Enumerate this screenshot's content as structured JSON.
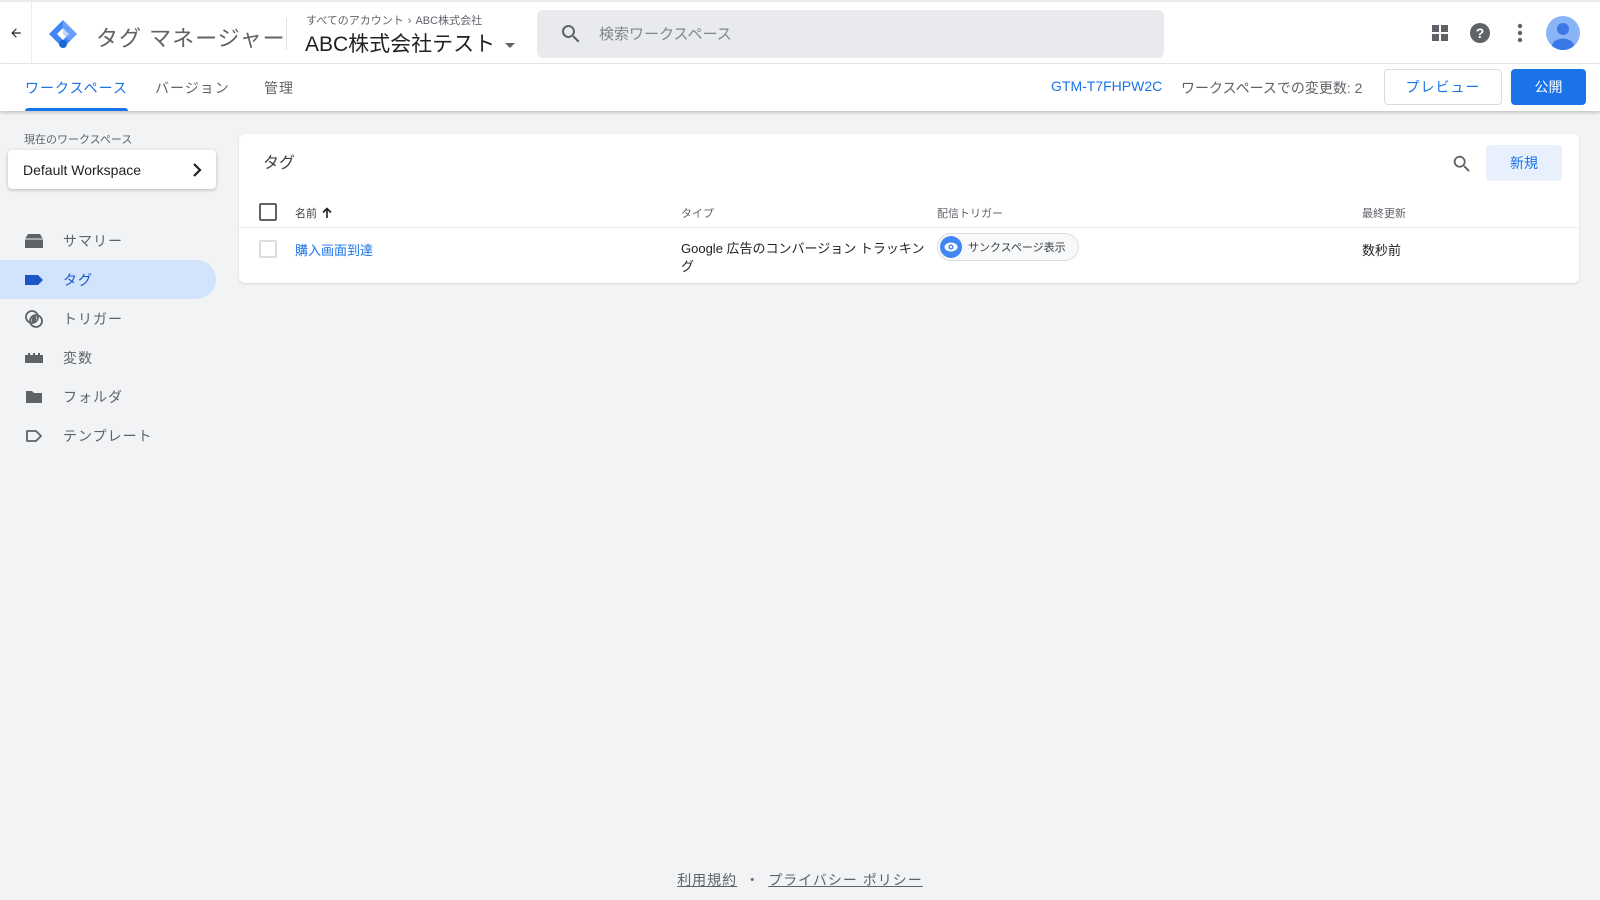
{
  "app": {
    "product_name": "タグ マネージャー",
    "breadcrumb": {
      "accounts": "すべてのアカウント",
      "separator": "›",
      "account": "ABC株式会社"
    },
    "container_name": "ABC株式会社テスト",
    "search_placeholder": "検索ワークスペース",
    "search_value": "",
    "icons": {
      "back": "arrow-back-icon",
      "logo": "tag-manager-logo",
      "search": "search-icon",
      "apps": "apps-grid-icon",
      "help": "help-icon",
      "more": "more-vert-icon",
      "account": "account-avatar"
    }
  },
  "subnav": {
    "tabs": [
      {
        "label": "ワークスペース",
        "active": true
      },
      {
        "label": "バージョン",
        "active": false
      },
      {
        "label": "管理",
        "active": false
      }
    ],
    "container_id": "GTM-T7FHPW2C",
    "changes_label": "ワークスペースでの変更数: 2",
    "preview_label": "プレビュー",
    "publish_label": "公開"
  },
  "sidebar": {
    "workspace_label": "現在のワークスペース",
    "workspace_name": "Default Workspace",
    "items": [
      {
        "label": "サマリー",
        "icon": "summary-icon",
        "active": false
      },
      {
        "label": "タグ",
        "icon": "tag-icon",
        "active": true
      },
      {
        "label": "トリガー",
        "icon": "trigger-icon",
        "active": false
      },
      {
        "label": "変数",
        "icon": "variable-icon",
        "active": false
      },
      {
        "label": "フォルダ",
        "icon": "folder-icon",
        "active": false
      },
      {
        "label": "テンプレート",
        "icon": "template-icon",
        "active": false
      }
    ]
  },
  "tags_panel": {
    "title": "タグ",
    "new_label": "新規",
    "columns": {
      "name": "名前",
      "type": "タイプ",
      "trigger": "配信トリガー",
      "updated": "最終更新"
    },
    "sort": {
      "column": "name",
      "direction": "ascending"
    },
    "rows": [
      {
        "name": "購入画面到達",
        "type": "Google 広告のコンバージョン トラッキング",
        "trigger": "サンクスページ表示",
        "updated": "数秒前",
        "checked": false
      }
    ]
  },
  "footer": {
    "terms": "利用規約",
    "separator": "・",
    "privacy": "プライバシー ポリシー"
  },
  "colors": {
    "accent": "#1a73e8",
    "active_nav_bg": "#d2e3fc",
    "page_bg": "#f1f3f4",
    "trigger_chip_icon": "#4285f4"
  }
}
